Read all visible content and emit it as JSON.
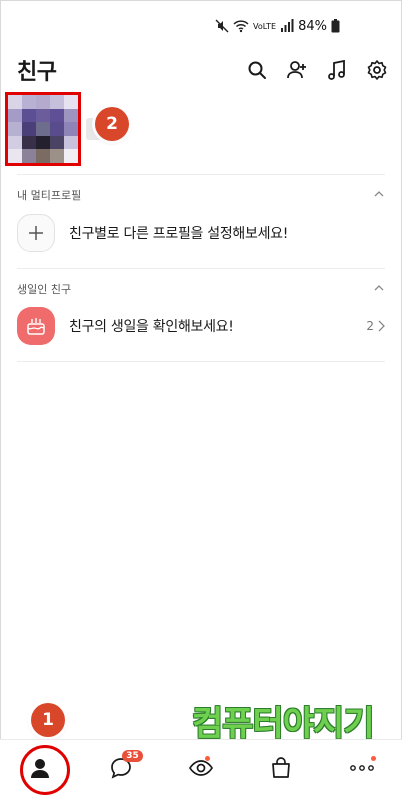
{
  "status_bar": {
    "battery": "84%",
    "volte": "VoLTE"
  },
  "header": {
    "title": "친구",
    "actions": [
      "search-icon",
      "add-friend-icon",
      "music-icon",
      "settings-icon"
    ]
  },
  "annotations": {
    "profile_marker": "2",
    "tab_marker": "1"
  },
  "multi_profile": {
    "section_title": "내 멀티프로필",
    "row_label": "친구별로 다른 프로필을 설정해보세요!"
  },
  "birthday": {
    "section_title": "생일인 친구",
    "row_label": "친구의 생일을 확인해보세요!",
    "count": "2"
  },
  "watermark": "컴퓨터야지기",
  "tabs": [
    {
      "name": "friends",
      "icon": "person-icon",
      "active": true
    },
    {
      "name": "chats",
      "icon": "chat-bubble-icon",
      "badge": "35"
    },
    {
      "name": "view",
      "icon": "eye-icon",
      "dot": true
    },
    {
      "name": "shopping",
      "icon": "shopping-bag-icon"
    },
    {
      "name": "more",
      "icon": "more-dots-icon",
      "dot": true
    }
  ],
  "colors": {
    "accent_red": "#e00000",
    "badge": "#e8503a",
    "birthday_tile": "#f06b6b"
  }
}
